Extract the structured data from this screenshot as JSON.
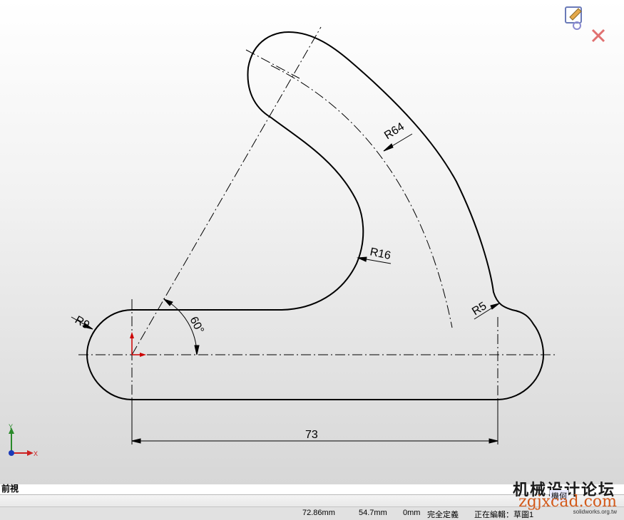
{
  "drawing": {
    "dimensions": {
      "r9": "R9",
      "r64": "R64",
      "r16": "R16",
      "r5": "R5",
      "angle": "60°",
      "length": "73"
    },
    "triad": {
      "y": "Y",
      "x": "X"
    },
    "view_name": "前視"
  },
  "confirm_icons": {
    "sketch": "sketch-exit-icon",
    "cancel": "cancel-x-icon"
  },
  "watermark": {
    "title": "机械设计论坛",
    "url": "zgjxcad.com",
    "logo": "機何",
    "sub": "solidworks.org.tw"
  },
  "status": {
    "x": "72.86mm",
    "y": "54.7mm",
    "z": "0mm",
    "state": "完全定義",
    "editing": "正在編輯：草圖1"
  },
  "colors": {
    "sketch_line": "#000000",
    "origin": "#cc0000",
    "axis_y": "#2a8a2a",
    "axis_x": "#cc2222",
    "axis_z": "#1a3ab8"
  }
}
